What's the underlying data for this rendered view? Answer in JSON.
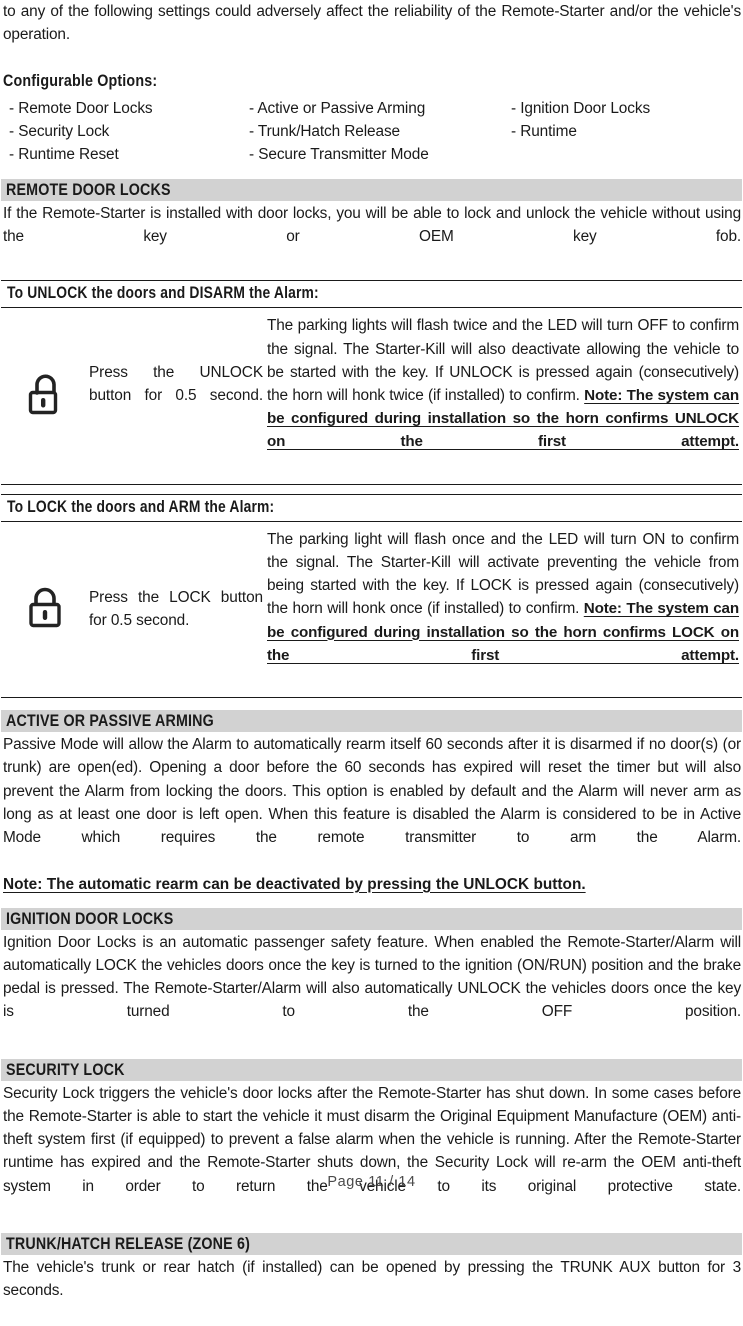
{
  "intro": {
    "paragraph": "to any of the following settings could adversely affect the reliability of the Remote-Starter and/or the vehicle's operation.",
    "configurable_options_label": "Configurable Options:",
    "options_columns": [
      [
        "- Remote Door Locks",
        "- Security Lock",
        "- Runtime Reset"
      ],
      [
        "- Active or Passive Arming",
        "- Trunk/Hatch Release",
        "- Secure Transmitter Mode"
      ],
      [
        "- Ignition Door Locks",
        "- Runtime",
        ""
      ]
    ]
  },
  "sections": {
    "remote_door_locks": {
      "heading": "REMOTE DOOR LOCKS",
      "body": "If the Remote-Starter is installed with door locks, you will be able to lock and unlock the vehicle without using the key or OEM key fob.",
      "unlock": {
        "caption": "To UNLOCK the doors and DISARM the Alarm:",
        "icon": "unlock-padlock-icon",
        "action": "Press the UNLOCK button for 0.5 second.",
        "description": "The parking lights will flash twice and the LED will turn OFF to confirm the signal. The Starter-Kill will also deactivate allowing the vehicle to be started with the key.  If UNLOCK is pressed again (consecutively) the horn will honk twice (if installed) to confirm. ",
        "note": "Note: The system can be configured during installation so the horn confirms UNLOCK on the first attempt. "
      },
      "lock": {
        "caption": "To LOCK the doors and ARM the Alarm:",
        "icon": "lock-padlock-icon",
        "action": "Press the LOCK button for 0.5 second.",
        "description": "The parking light will flash once and the LED will turn ON to confirm the signal. The Starter-Kill will activate preventing the vehicle from being started with the key.  If LOCK is pressed again (consecutively) the horn will honk once (if installed) to confirm. ",
        "note": "Note: The system can be configured during installation so the horn confirms LOCK on the first attempt."
      }
    },
    "active_or_passive_arming": {
      "heading": "ACTIVE OR PASSIVE ARMING",
      "body": "Passive Mode will allow the Alarm to automatically rearm itself 60 seconds after it is disarmed if no door(s) (or trunk) are open(ed). Opening a door before the 60 seconds has expired will reset the timer but will also prevent the Alarm from locking the doors. This option is enabled by default and the Alarm will never arm as long as at least one door is left open. When this feature is disabled the Alarm is considered to be in Active Mode which requires the remote transmitter to arm the Alarm.",
      "note": "Note: The automatic rearm can be deactivated by pressing the UNLOCK button."
    },
    "ignition_door_locks": {
      "heading": "IGNITION DOOR LOCKS",
      "body": "Ignition Door Locks is an automatic passenger safety feature. When enabled the Remote-Starter/Alarm will automatically LOCK the vehicles doors once the key is turned to the ignition (ON/RUN) position and the brake pedal is pressed. The Remote-Starter/Alarm will also automatically UNLOCK the vehicles doors once the key is turned to the OFF position."
    },
    "security_lock": {
      "heading": "SECURITY LOCK",
      "body": "Security Lock triggers the vehicle's door locks after the Remote-Starter has shut down. In some cases before the Remote-Starter is able to start the vehicle it must disarm the Original Equipment Manufacture (OEM) anti-theft system first (if equipped) to prevent a false alarm when the vehicle is running. After the Remote-Starter runtime has expired and the Remote-Starter shuts down, the Security Lock will re-arm the OEM anti-theft system in order to return the vehicle to its original protective state."
    },
    "trunk_hatch_release": {
      "heading": "TRUNK/HATCH RELEASE  (ZONE 6)",
      "body": "The vehicle's trunk or rear hatch (if installed) can be opened by pressing the TRUNK AUX button for 3 seconds."
    }
  },
  "footer": {
    "page_label": "Page 11 / 14"
  },
  "colors": {
    "section_header_bg": "#d2d2d2",
    "text": "#1a1a1a",
    "rule": "#1a1a1a",
    "footer_text": "#4a4a4a"
  }
}
